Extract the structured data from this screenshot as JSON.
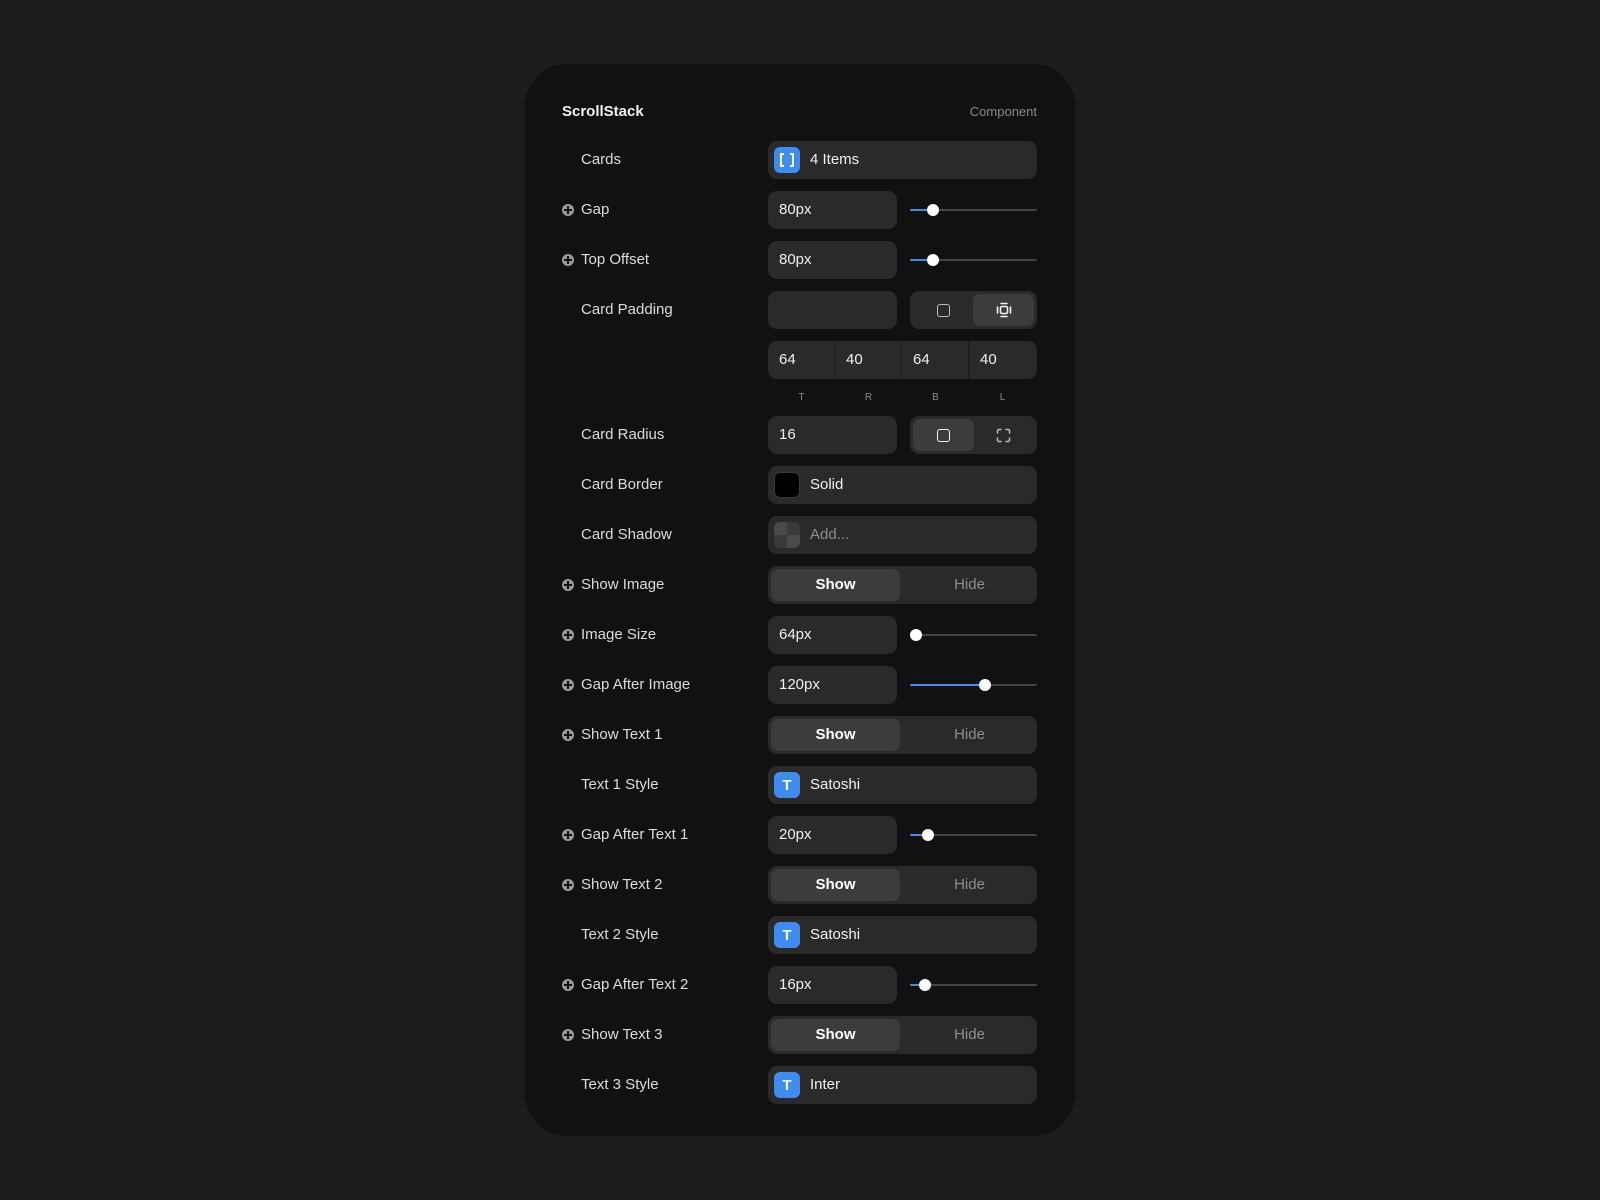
{
  "header": {
    "title": "ScrollStack",
    "subtitle": "Component"
  },
  "accent_color": "#3e8cf2",
  "rows": {
    "cards": {
      "label": "Cards",
      "value": "4 Items",
      "icon": "brackets-icon"
    },
    "gap": {
      "label": "Gap",
      "value": "80px",
      "slider_fraction": 0.18
    },
    "top_offset": {
      "label": "Top Offset",
      "value": "80px",
      "slider_fraction": 0.18
    },
    "card_padding": {
      "label": "Card Padding",
      "value": "",
      "mode_options": [
        "uniform",
        "per-side"
      ],
      "mode_selected": "per-side",
      "sides": [
        {
          "label": "T",
          "value": "64"
        },
        {
          "label": "R",
          "value": "40"
        },
        {
          "label": "B",
          "value": "64"
        },
        {
          "label": "L",
          "value": "40"
        }
      ]
    },
    "card_radius": {
      "label": "Card Radius",
      "value": "16",
      "mode_options": [
        "uniform",
        "per-corner"
      ],
      "mode_selected": "uniform"
    },
    "card_border": {
      "label": "Card Border",
      "value": "Solid",
      "color": "#000000"
    },
    "card_shadow": {
      "label": "Card Shadow",
      "placeholder": "Add..."
    },
    "show_image": {
      "label": "Show Image",
      "on": "Show",
      "off": "Hide",
      "selected": "Show"
    },
    "image_size": {
      "label": "Image Size",
      "value": "64px",
      "slider_fraction": 0.05
    },
    "gap_after_image": {
      "label": "Gap After Image",
      "value": "120px",
      "slider_fraction": 0.59
    },
    "show_text1": {
      "label": "Show Text 1",
      "on": "Show",
      "off": "Hide",
      "selected": "Show"
    },
    "text1_style": {
      "label": "Text 1 Style",
      "value": "Satoshi",
      "icon_glyph": "T"
    },
    "gap_after_text1": {
      "label": "Gap After Text 1",
      "value": "20px",
      "slider_fraction": 0.14
    },
    "show_text2": {
      "label": "Show Text 2",
      "on": "Show",
      "off": "Hide",
      "selected": "Show"
    },
    "text2_style": {
      "label": "Text 2 Style",
      "value": "Satoshi",
      "icon_glyph": "T"
    },
    "gap_after_text2": {
      "label": "Gap After Text 2",
      "value": "16px",
      "slider_fraction": 0.12
    },
    "show_text3": {
      "label": "Show Text 3",
      "on": "Show",
      "off": "Hide",
      "selected": "Show"
    },
    "text3_style": {
      "label": "Text 3 Style",
      "value": "Inter",
      "icon_glyph": "T"
    }
  }
}
